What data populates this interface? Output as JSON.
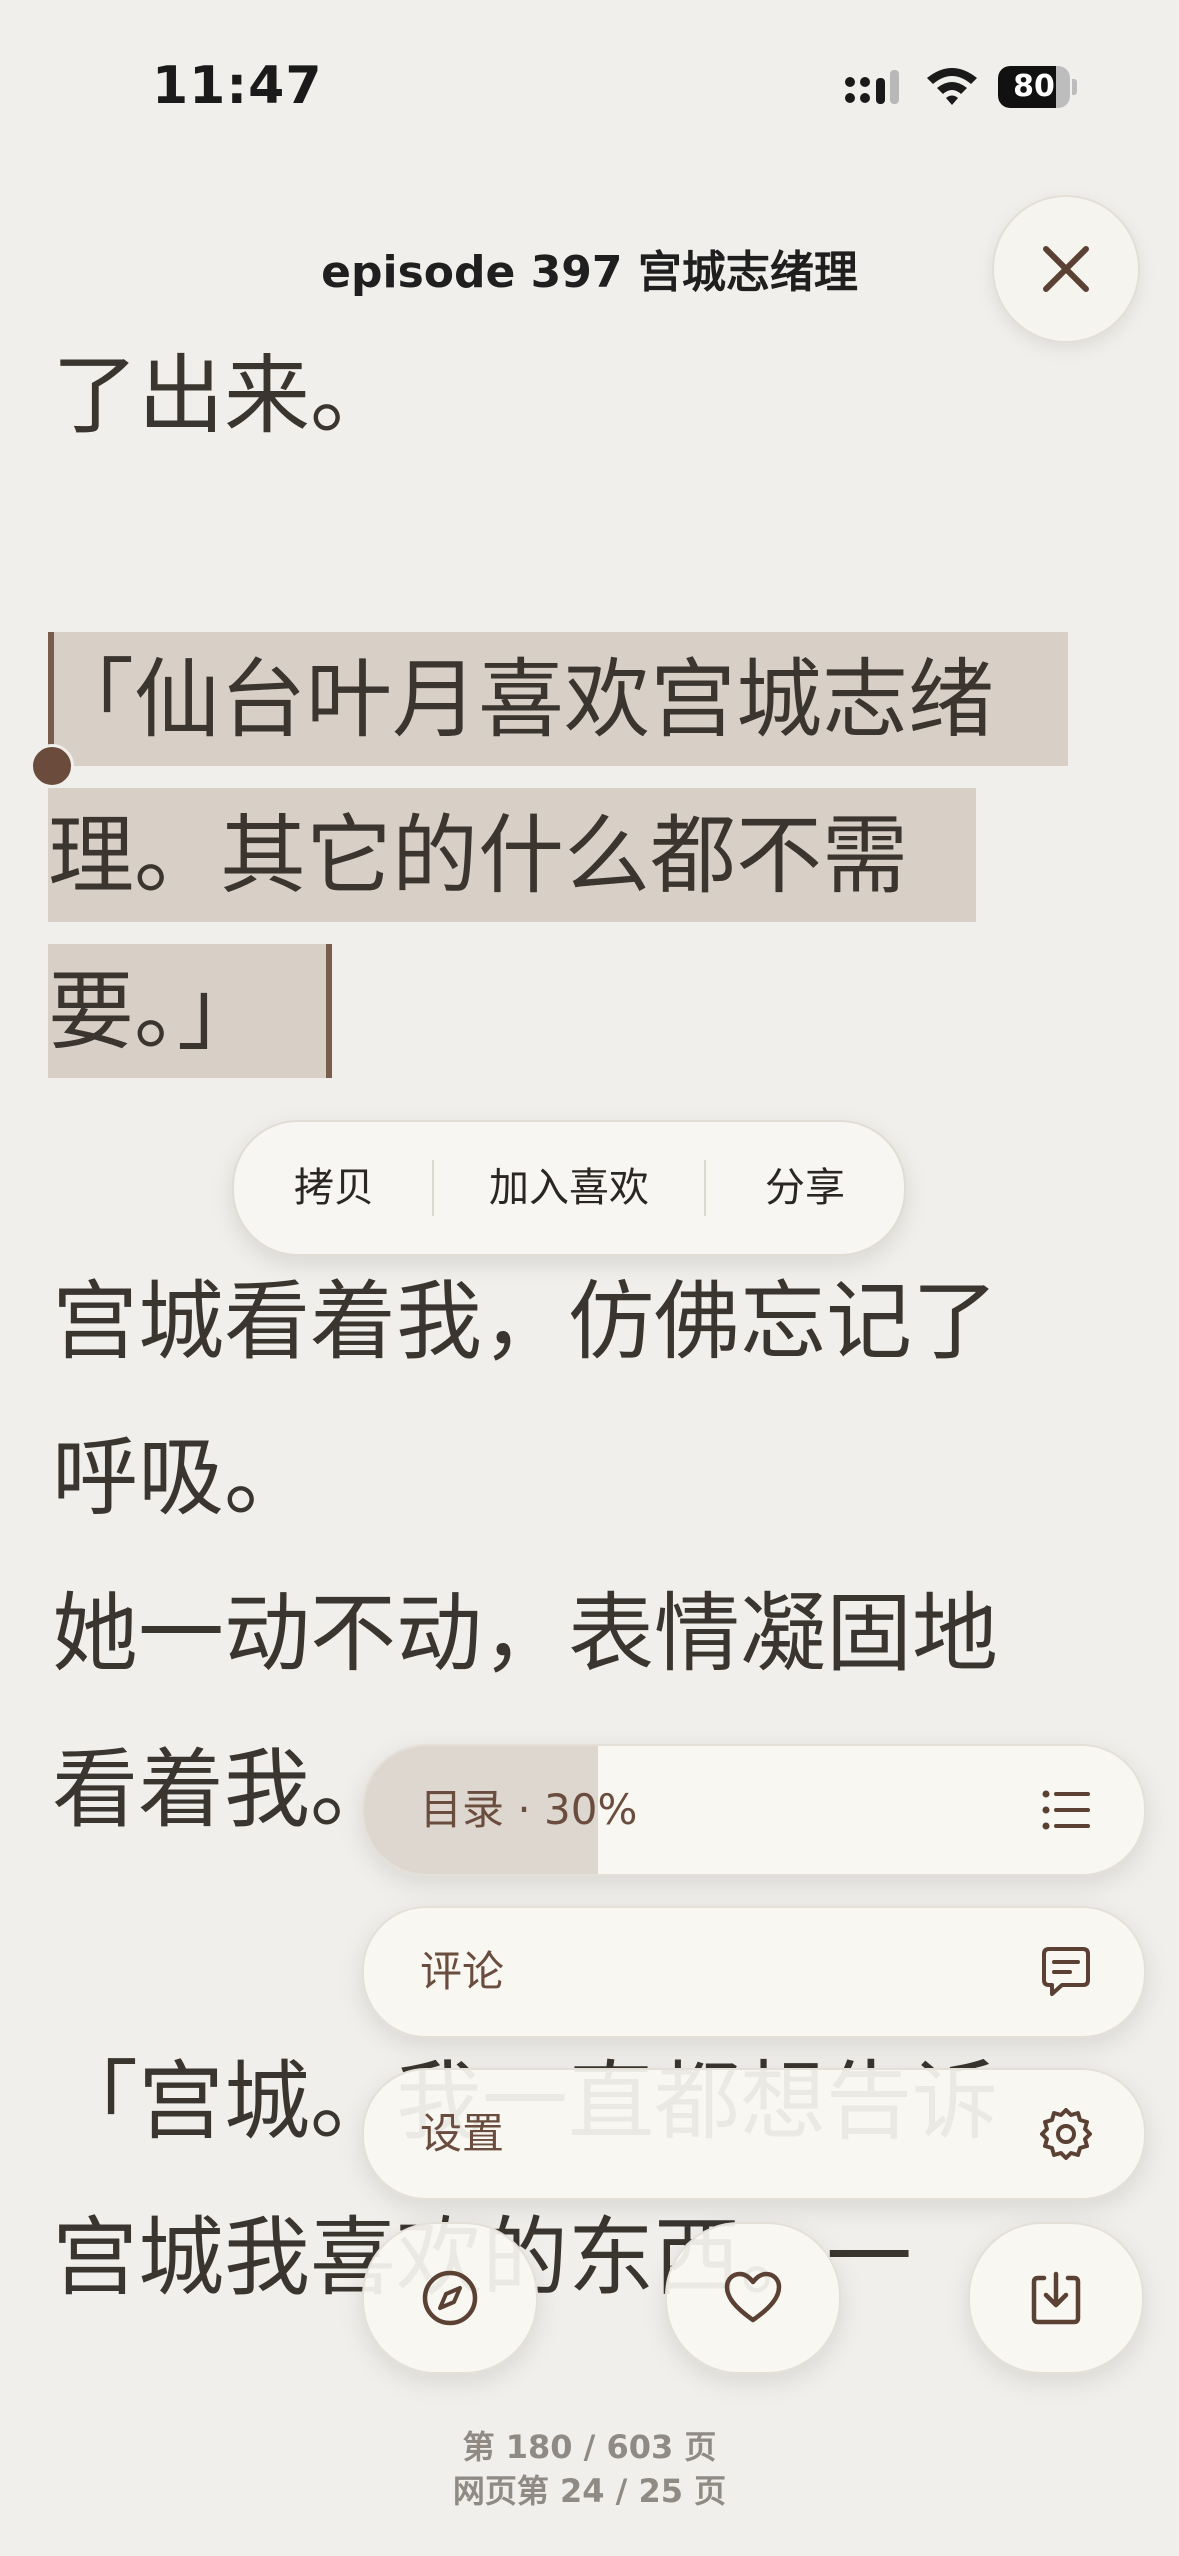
{
  "status_bar": {
    "time": "11:47",
    "battery": "80",
    "battery_level": 0.8
  },
  "header": {
    "title": "episode 397 宫城志绪理"
  },
  "reader": {
    "line_1": "了出来。",
    "quote_line_1": "「仙台叶月喜欢宫城志绪",
    "quote_line_2": "理。其它的什么都不需",
    "quote_line_3": "要。」",
    "line_4": "宫城看着我，仿佛忘记了",
    "line_5": "呼吸。",
    "line_6": "她一动不动，表情凝固地",
    "line_7": "看着我。",
    "line_8": "「宫城。我一直都想告诉",
    "line_9": "宫城我喜欢的东西。一"
  },
  "context_menu": {
    "copy": "拷贝",
    "favorite": "加入喜欢",
    "share": "分享"
  },
  "floating_menu": {
    "toc_label": "目录 · 30%",
    "toc_progress": 0.3,
    "comments_label": "评论",
    "settings_label": "设置",
    "icons": [
      "list-icon",
      "comment-icon",
      "gear-icon",
      "compass-icon",
      "heart-icon",
      "download-icon"
    ]
  },
  "footer": {
    "book_page": "第 180 / 603 页",
    "web_page": "网页第 24 / 25 页"
  },
  "colors": {
    "background": "#f1efeb",
    "highlight": "#d8d0c6",
    "accent": "#6a4d3f"
  }
}
